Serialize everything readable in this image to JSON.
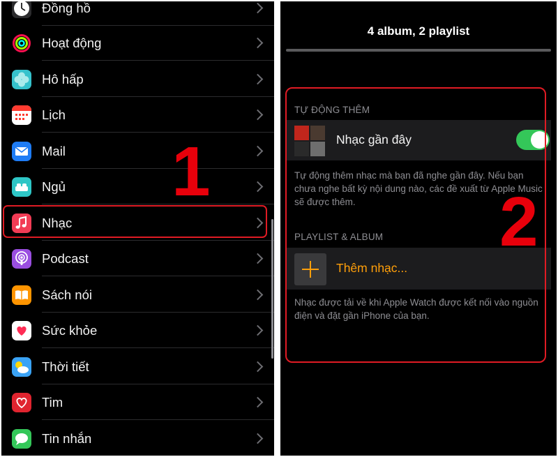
{
  "settings_list": {
    "items": [
      {
        "label": "Đồng hồ",
        "icon": "clock-icon",
        "color": "#2c2c2e"
      },
      {
        "label": "Hoạt động",
        "icon": "activity-rings-icon",
        "color": "#000000"
      },
      {
        "label": "Hô hấp",
        "icon": "breathe-icon",
        "color": "#35c2cc"
      },
      {
        "label": "Lịch",
        "icon": "calendar-icon",
        "color": "#ffffff"
      },
      {
        "label": "Mail",
        "icon": "mail-icon",
        "color": "#1e7cf5"
      },
      {
        "label": "Ngủ",
        "icon": "sleep-icon",
        "color": "#2ec6c6"
      },
      {
        "label": "Nhạc",
        "icon": "music-note-icon",
        "color": "#f23c55"
      },
      {
        "label": "Podcast",
        "icon": "podcast-icon",
        "color": "#9a4ee0"
      },
      {
        "label": "Sách nói",
        "icon": "audiobook-icon",
        "color": "#ff9500"
      },
      {
        "label": "Sức khỏe",
        "icon": "heart-icon",
        "color": "#ffffff"
      },
      {
        "label": "Thời tiết",
        "icon": "weather-icon",
        "color": "#3aa3f5"
      },
      {
        "label": "Tim",
        "icon": "heart-rate-icon",
        "color": "#e0242f"
      },
      {
        "label": "Tin nhắn",
        "icon": "message-icon",
        "color": "#34c759"
      }
    ]
  },
  "annotations": {
    "step1": "1",
    "step2": "2",
    "color": "#e8000b"
  },
  "music_screen": {
    "title": "4 album, 2 playlist",
    "auto_add_header": "TỰ ĐỘNG THÊM",
    "recent_music_label": "Nhạc gần đây",
    "recent_music_enabled": true,
    "auto_add_footer": "Tự động thêm nhạc mà bạn đã nghe gần đây. Nếu bạn chưa nghe bất kỳ nội dung nào, các đề xuất từ Apple Music sẽ được thêm.",
    "playlist_header": "PLAYLIST & ALBUM",
    "add_music_label": "Thêm nhạc...",
    "add_music_color": "#ff9f0a",
    "playlist_footer": "Nhạc được tải về khi Apple Watch được kết nối vào nguồn điện và đặt gần iPhone của bạn."
  }
}
